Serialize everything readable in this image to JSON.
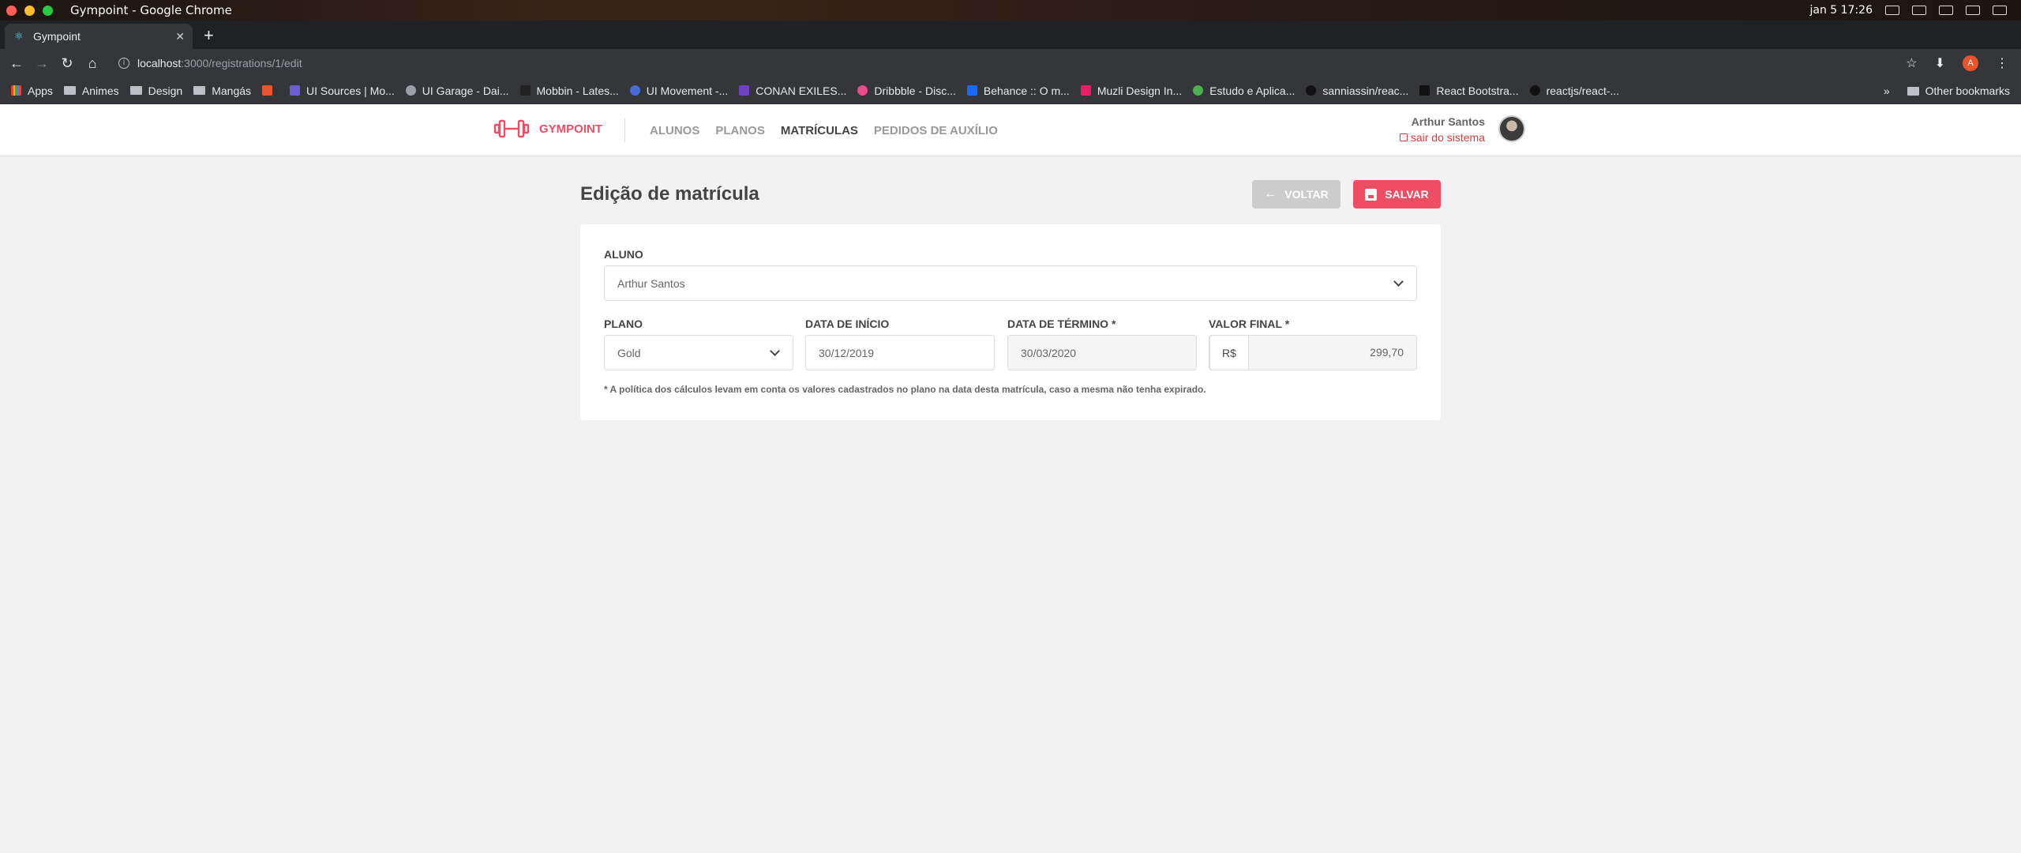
{
  "os": {
    "window_title": "Gympoint - Google Chrome",
    "clock": "jan 5  17:26"
  },
  "browser": {
    "tab_title": "Gympoint",
    "url_host": "localhost",
    "url_path": ":3000/registrations/1/edit",
    "profile_initial": "A",
    "bookmarks": [
      "Apps",
      "Animes",
      "Design",
      "Mangás",
      "",
      "UI Sources | Mo...",
      "UI Garage - Dai...",
      "Mobbin - Lates...",
      "UI Movement -...",
      "CONAN EXILES...",
      "Dribbble - Disc...",
      "Behance :: O m...",
      "Muzli Design In...",
      "Estudo e Aplica...",
      "sanniassin/reac...",
      "React Bootstra...",
      "reactjs/react-..."
    ],
    "more_bookmarks": "»",
    "other_bookmarks": "Other bookmarks"
  },
  "header": {
    "logo": "GYMPOINT",
    "nav": [
      "ALUNOS",
      "PLANOS",
      "MATRÍCULAS",
      "PEDIDOS DE AUXÍLIO"
    ],
    "active_nav": "MATRÍCULAS",
    "user_name": "Arthur Santos",
    "logout": "sair do sistema"
  },
  "page": {
    "title": "Edição de matrícula",
    "back_label": "VOLTAR",
    "save_label": "SALVAR"
  },
  "form": {
    "student_label": "ALUNO",
    "student_value": "Arthur Santos",
    "plan_label": "PLANO",
    "plan_value": "Gold",
    "start_label": "DATA DE INÍCIO",
    "start_value": "30/12/2019",
    "end_label": "DATA DE TÉRMINO *",
    "end_value": "30/03/2020",
    "price_label": "VALOR FINAL *",
    "currency": "R$",
    "price_value": "299,70",
    "note": "* A política dos cálculos levam em conta os valores cadastrados no plano na data desta matrícula, caso a mesma não tenha expirado."
  },
  "colors": {
    "brand": "#ee4d64",
    "back_button": "#cccccc",
    "logout": "#de3b3b"
  }
}
